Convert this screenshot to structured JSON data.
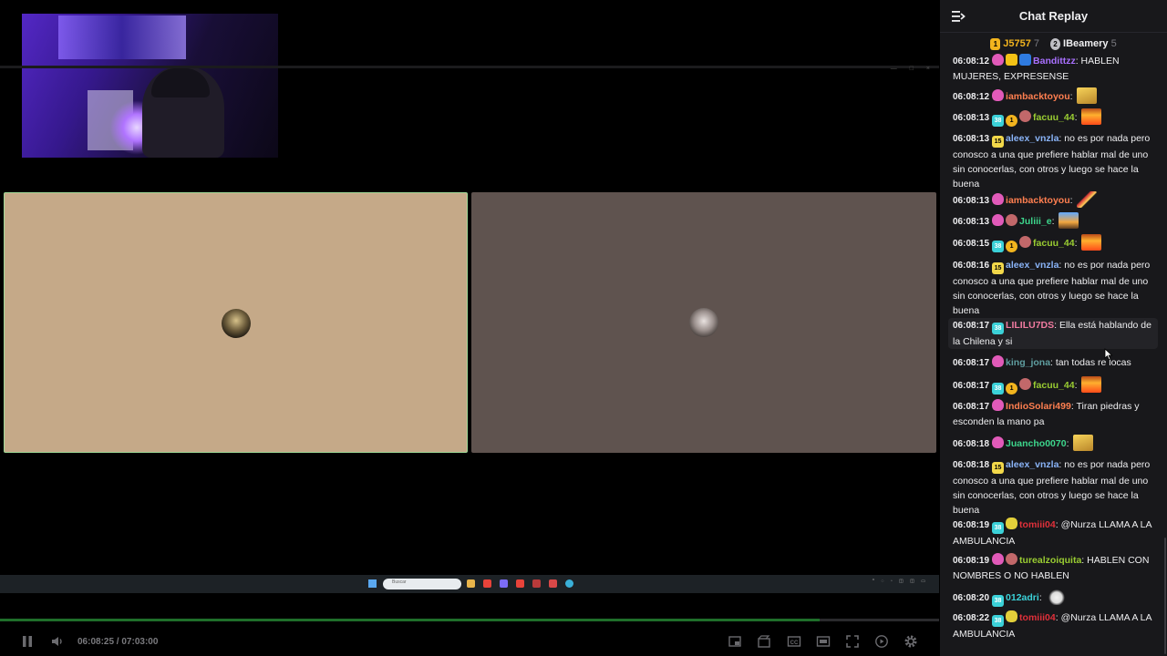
{
  "chat": {
    "title": "Chat Replay",
    "leaderboard": [
      {
        "rank": "1",
        "name": "J5757",
        "count": "7",
        "color": "#f2b41e",
        "badge_color": "#f2b41e"
      },
      {
        "rank": "2",
        "name": "IBeamery",
        "count": "5",
        "color": "#efeff1",
        "badge_color": "#bfbfc4"
      }
    ],
    "messages": [
      {
        "time": "06:08:12",
        "badges": [
          "pink",
          "crown",
          "prime"
        ],
        "user": "Bandittzz",
        "color": "#a970ff",
        "text": "HABLEN MUJERES, EXPRESENSE",
        "emote": ""
      },
      {
        "time": "06:08:12",
        "badges": [
          "pink"
        ],
        "user": "iambacktoyou",
        "color": "#ff7f50",
        "text": "",
        "emote": "gold"
      },
      {
        "time": "06:08:13",
        "badges": [
          "cyan",
          "gold",
          "face"
        ],
        "user": "facuu_44",
        "color": "#9acd32",
        "text": "",
        "emote": "fire"
      },
      {
        "time": "06:08:13",
        "badges": [
          "yellow"
        ],
        "user": "aleex_vnzla",
        "color": "#8ab4f8",
        "text": "no es por nada pero conosco a una que prefiere hablar mal de uno sin conocerlas, con otros y luego se hace la buena",
        "emote": ""
      },
      {
        "time": "06:08:13",
        "badges": [
          "pink"
        ],
        "user": "iambacktoyou",
        "color": "#ff7f50",
        "text": "",
        "emote": "knife"
      },
      {
        "time": "06:08:13",
        "badges": [
          "pink",
          "face"
        ],
        "user": "Juliii_e",
        "color": "#3dd68c",
        "text": "",
        "emote": "sunset"
      },
      {
        "time": "06:08:15",
        "badges": [
          "cyan",
          "gold",
          "face"
        ],
        "user": "facuu_44",
        "color": "#9acd32",
        "text": "",
        "emote": "fire"
      },
      {
        "time": "06:08:16",
        "badges": [
          "yellow"
        ],
        "user": "aleex_vnzla",
        "color": "#8ab4f8",
        "text": "no es por nada pero conosco a una que prefiere hablar mal de uno sin conocerlas, con otros y luego se hace la buena",
        "emote": ""
      },
      {
        "time": "06:08:17",
        "badges": [
          "cyan"
        ],
        "user": "LILILU7DS",
        "color": "#f07ba0",
        "text": "Ella está hablando de la Chilena y si",
        "emote": ""
      },
      {
        "time": "06:08:17",
        "badges": [
          "pink"
        ],
        "user": "king_jona",
        "color": "#5f9ea0",
        "text": "tan todas re locas",
        "emote": ""
      },
      {
        "time": "06:08:17",
        "badges": [
          "cyan",
          "gold",
          "face"
        ],
        "user": "facuu_44",
        "color": "#9acd32",
        "text": "",
        "emote": "fire"
      },
      {
        "time": "06:08:17",
        "badges": [
          "pink"
        ],
        "user": "IndioSolari499",
        "color": "#ff7f50",
        "text": "Tiran piedras y esconden la mano pa",
        "emote": ""
      },
      {
        "time": "06:08:18",
        "badges": [
          "pink"
        ],
        "user": "Juancho0070",
        "color": "#3dd68c",
        "text": "",
        "emote": "gold"
      },
      {
        "time": "06:08:18",
        "badges": [
          "yellow"
        ],
        "user": "aleex_vnzla",
        "color": "#8ab4f8",
        "text": "no es por nada pero conosco a una que prefiere hablar mal de uno sin conocerlas, con otros y luego se hace la buena",
        "emote": ""
      },
      {
        "time": "06:08:19",
        "badges": [
          "cyan",
          "bird"
        ],
        "user": "tomiii04",
        "color": "#e0303a",
        "text": "@Nurza LLAMA A LA AMBULANCIA",
        "emote": ""
      },
      {
        "time": "06:08:19",
        "badges": [
          "pink",
          "face"
        ],
        "user": "turealzoiquita",
        "color": "#9acd32",
        "text": "HABLEN CON NOMBRES O NO HABLEN",
        "emote": ""
      },
      {
        "time": "06:08:20",
        "badges": [
          "cyan"
        ],
        "user": "012adri",
        "color": "#3bd1d8",
        "text": "",
        "emote": "goose"
      },
      {
        "time": "06:08:22",
        "badges": [
          "cyan",
          "bird"
        ],
        "user": "tomiii04",
        "color": "#e0303a",
        "text": "@Nurza LLAMA A LA AMBULANCIA",
        "emote": ""
      }
    ]
  },
  "player": {
    "current_time": "06:08:25",
    "separator": " / ",
    "duration": "07:03:00",
    "played_fraction": 0.873,
    "buffered_fraction": 0.873
  },
  "embedded_screen": {
    "search_placeholder": "Buscar"
  },
  "icons": {
    "pause": "pause-icon",
    "volume": "volume-icon",
    "miniplayer": "miniplayer-icon",
    "clip": "clip-icon",
    "captions": "captions-icon",
    "theater": "theater-icon",
    "fullscreen": "fullscreen-icon",
    "autoplay": "autoplay-icon",
    "settings": "gear-icon",
    "collapse": "collapse-chat-icon"
  },
  "colors": {
    "accent": "#1f6f2a",
    "chat_bg": "#18181b",
    "tile_left": "#c5a988",
    "tile_right": "#5f534f"
  }
}
